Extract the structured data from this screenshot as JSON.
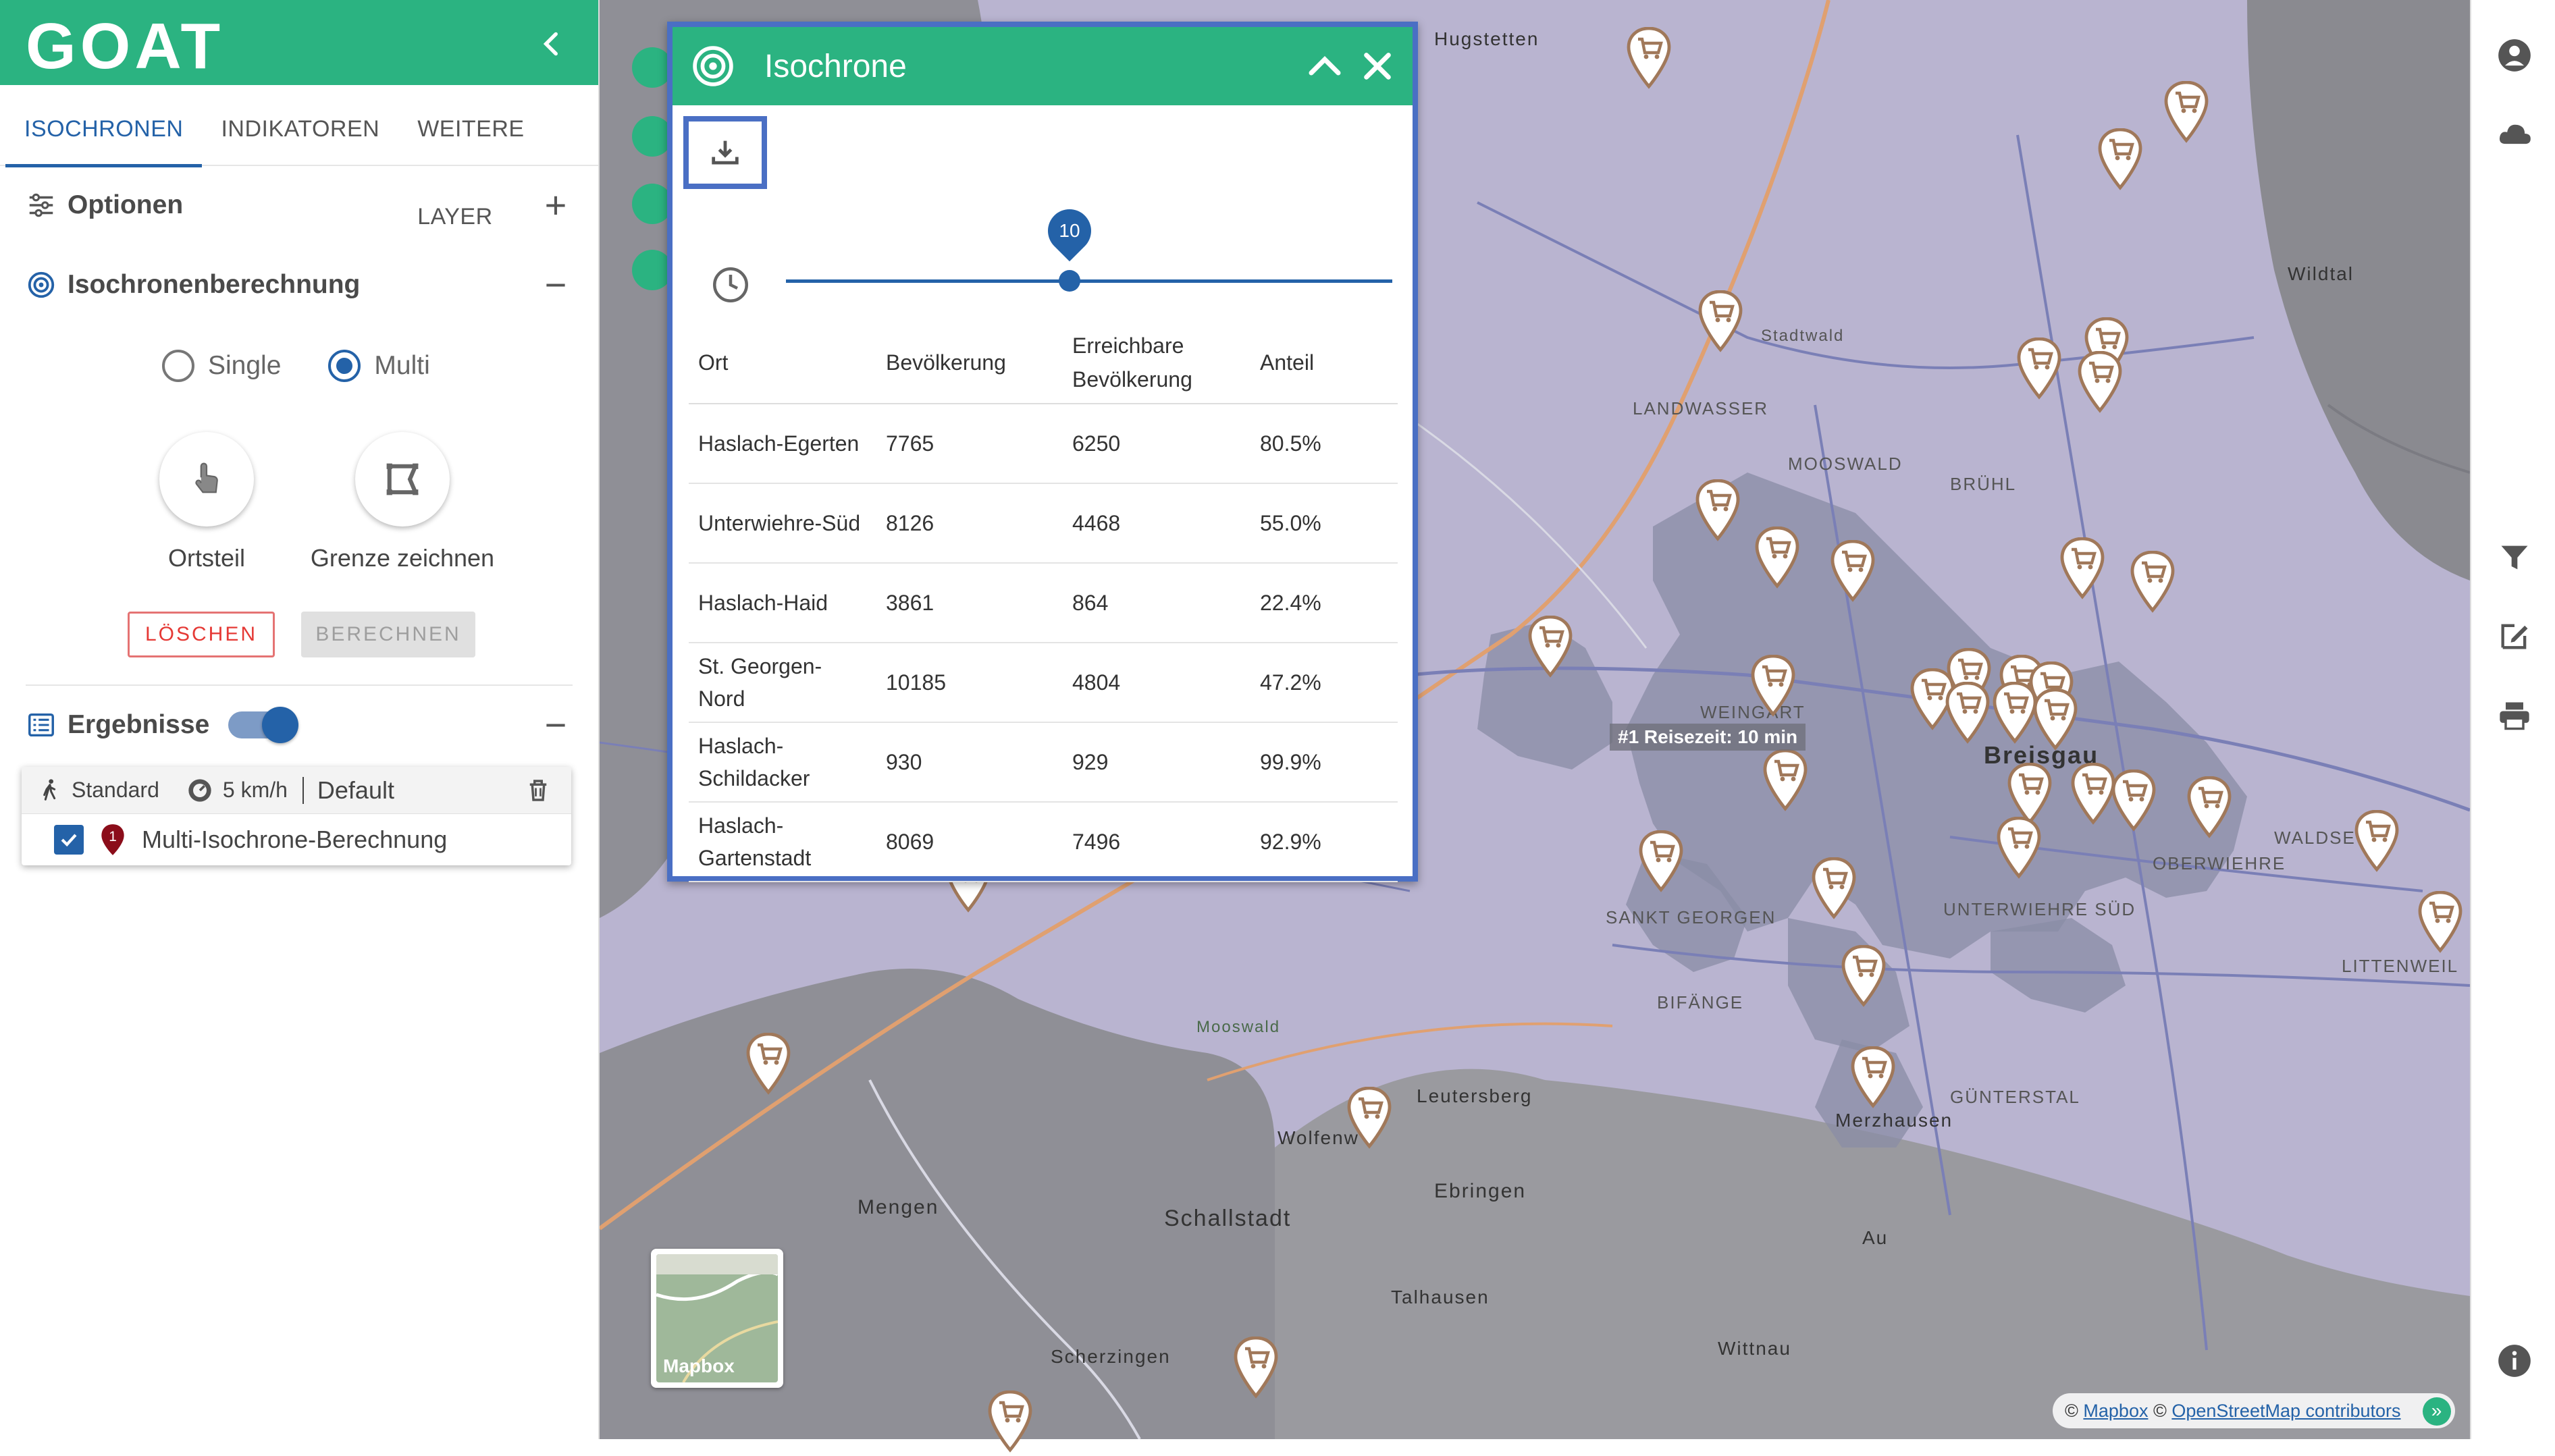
{
  "app": {
    "logo": "GOAT"
  },
  "tabs": [
    {
      "label": "ISOCHRONEN"
    },
    {
      "label": "INDIKATOREN"
    },
    {
      "label": "WEITERE LAYER"
    }
  ],
  "options": {
    "title": "Optionen"
  },
  "calc": {
    "title": "Isochronenberechnung",
    "radio_single": "Single",
    "radio_multi": "Multi",
    "mode_district": "Ortsteil",
    "mode_draw": "Grenze zeichnen",
    "btn_delete": "LÖSCHEN",
    "btn_compute": "BERECHNEN"
  },
  "results": {
    "title": "Ergebnisse",
    "profile": "Standard",
    "speed": "5 km/h",
    "scenario": "Default",
    "badge": "1",
    "item": "Multi-Isochrone-Berechnung"
  },
  "panel": {
    "title": "Isochrone",
    "slider_value": "10",
    "headers": {
      "ort": "Ort",
      "bev": "Bevölkerung",
      "erreich": "Erreichbare Bevölkerung",
      "anteil": "Anteil"
    },
    "rows": [
      {
        "ort": "Haslach-Egerten",
        "bev": "7765",
        "erreich": "6250",
        "anteil": "80.5%"
      },
      {
        "ort": "Unterwiehre-Süd",
        "bev": "8126",
        "erreich": "4468",
        "anteil": "55.0%"
      },
      {
        "ort": "Haslach-Haid",
        "bev": "3861",
        "erreich": "864",
        "anteil": "22.4%"
      },
      {
        "ort": "St. Georgen-Nord",
        "bev": "10185",
        "erreich": "4804",
        "anteil": "47.2%"
      },
      {
        "ort": "Haslach-Schildacker",
        "bev": "930",
        "erreich": "929",
        "anteil": "99.9%"
      },
      {
        "ort": "Haslach-Gartenstadt",
        "bev": "8069",
        "erreich": "7496",
        "anteil": "92.9%"
      }
    ]
  },
  "map": {
    "tooltip": "#1 Reisezeit: 10 min",
    "basemap_label": "Mapbox",
    "attr_mapbox": "Mapbox",
    "attr_osm": "OpenStreetMap contributors",
    "labels": {
      "landwasser": "LANDWASSER",
      "mooswald": "MOOSWALD",
      "bruehl": "BRÜHL",
      "weingarten": "WEINGART",
      "breisgau": "Breisgau",
      "sankt_georgen": "SANKT GEORGEN",
      "wiehre": "UNTERWIEHRE SÜD",
      "guenterstal": "GÜNTERSTAL",
      "littenweiler": "LITTENWEIL",
      "schallstadt": "Schallstadt",
      "mengen": "Mengen",
      "ebringen": "Ebringen",
      "leutersberg": "Leutersberg",
      "wolfenweiler": "Wolfenw",
      "merzhausen": "Merzhausen",
      "au": "Au",
      "talhausen": "Talhausen",
      "scherzingen": "Scherzingen",
      "wittnau": "Wittnau",
      "hugstetten": "Hugstetten",
      "wildtal": "Wildtal",
      "stadtwald": "Stadtwald",
      "mooswald_sued": "Mooswald",
      "bifaenge": "BIFÄNGE",
      "oberwiehre": "OBERWIEHRE",
      "waldsee": "WALDSE"
    }
  },
  "colors": {
    "green": "#2bb381",
    "blue": "#2462a8",
    "panel_border": "#4a6fc4",
    "map_bg": "#b9b4d0",
    "iso_fill": "#8a8ca6",
    "marker": "#a0785a",
    "delete_red": "#e53935"
  },
  "icons": {
    "collapse": "chevron-left-icon",
    "options": "sliders-icon",
    "calc": "target-icon",
    "results": "list-icon",
    "walk": "walking-icon",
    "speed": "speedometer-icon",
    "delete": "trash-icon",
    "download": "download-icon",
    "clock": "clock-icon",
    "collapse_panel": "chevron-up-icon",
    "close": "close-icon",
    "user": "user-icon",
    "cloud": "cloud-icon",
    "filter": "filter-icon",
    "edit": "edit-icon",
    "print": "print-icon",
    "info": "info-icon",
    "store": "shopping-cart-icon"
  }
}
